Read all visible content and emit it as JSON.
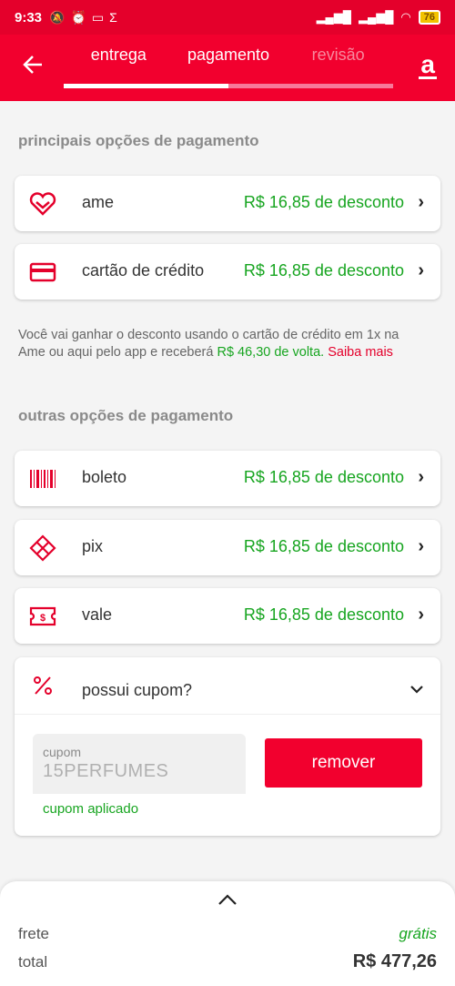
{
  "status": {
    "time": "9:33",
    "battery": "76"
  },
  "tabs": [
    {
      "label": "entrega"
    },
    {
      "label": "pagamento"
    },
    {
      "label": "revisão"
    }
  ],
  "logo": "a",
  "progress_fraction": 0.5,
  "main_section": "principais opções de pagamento",
  "main_options": [
    {
      "label": "ame",
      "discount": "R$ 16,85 de desconto",
      "icon": "heart-icon"
    },
    {
      "label": "cartão de crédito",
      "discount": "R$ 16,85 de desconto",
      "icon": "credit-card-icon"
    }
  ],
  "note": {
    "text1": "Você vai ganhar o desconto usando o cartão de crédito em 1x na Ame ou aqui pelo app e receberá ",
    "cashback": "R$ 46,30 de volta.",
    "link": "Saiba mais"
  },
  "other_section": "outras opções de pagamento",
  "other_options": [
    {
      "label": "boleto",
      "discount": "R$ 16,85 de desconto",
      "icon": "barcode-icon"
    },
    {
      "label": "pix",
      "discount": "R$ 16,85 de desconto",
      "icon": "pix-icon"
    },
    {
      "label": "vale",
      "discount": "R$ 16,85 de desconto",
      "icon": "voucher-icon"
    }
  ],
  "coupon": {
    "title": "possui cupom?",
    "field_label": "cupom",
    "value": "15PERFUMES",
    "remove_label": "remover",
    "status": "cupom aplicado"
  },
  "summary": {
    "frete_label": "frete",
    "frete_value": "grátis",
    "total_label": "total",
    "total_value": "R$ 477,26"
  },
  "colors": {
    "brand": "#f2002e",
    "discount": "#17a520"
  }
}
